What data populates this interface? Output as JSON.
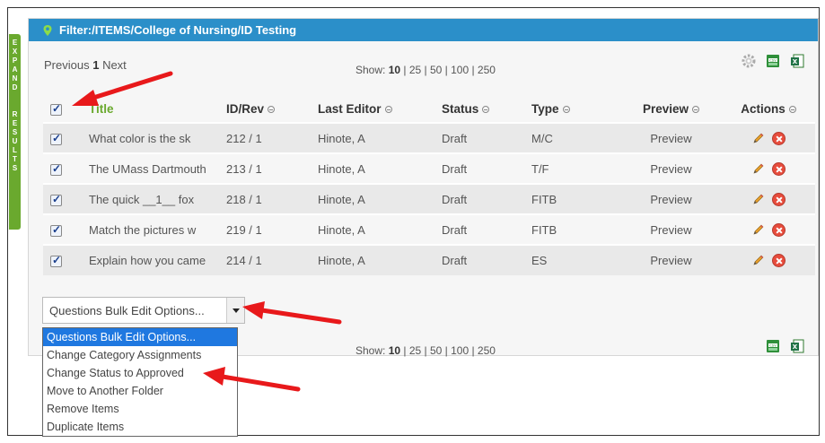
{
  "sidebar": {
    "expand_label": "EXPAND RESULTS"
  },
  "filter": {
    "label": "Filter:",
    "path": " /ITEMS/College of Nursing/ID Testing"
  },
  "pager": {
    "previous": "Previous",
    "current": "1",
    "next": "Next"
  },
  "show": {
    "label": "Show:",
    "current": "10",
    "others": "| 25 | 50 | 100 | 250"
  },
  "toolbar": {
    "settings_icon": "gear-icon",
    "csv_icon": "csv-icon",
    "excel_icon": "excel-icon"
  },
  "table": {
    "headers": {
      "title": "Title",
      "id_rev": "ID/Rev",
      "last_editor": "Last Editor",
      "status": "Status",
      "type": "Type",
      "preview": "Preview",
      "actions": "Actions"
    },
    "rows": [
      {
        "title": "What color is the sk",
        "id_rev": "212 / 1",
        "editor": "Hinote, A",
        "status": "Draft",
        "type": "M/C",
        "preview": "Preview"
      },
      {
        "title": "The UMass Dartmouth",
        "id_rev": "213 / 1",
        "editor": "Hinote, A",
        "status": "Draft",
        "type": "T/F",
        "preview": "Preview"
      },
      {
        "title": "The quick __1__ fox",
        "id_rev": "218 / 1",
        "editor": "Hinote, A",
        "status": "Draft",
        "type": "FITB",
        "preview": "Preview"
      },
      {
        "title": "Match the pictures w",
        "id_rev": "219 / 1",
        "editor": "Hinote, A",
        "status": "Draft",
        "type": "FITB",
        "preview": "Preview"
      },
      {
        "title": "Explain how you came",
        "id_rev": "214 / 1",
        "editor": "Hinote, A",
        "status": "Draft",
        "type": "ES",
        "preview": "Preview"
      }
    ]
  },
  "bulk_edit": {
    "selected": "Questions Bulk Edit Options...",
    "options": [
      "Questions Bulk Edit Options...",
      "Change Category Assignments",
      "Change Status to Approved",
      "Move to Another Folder",
      "Remove Items",
      "Duplicate Items"
    ]
  },
  "colors": {
    "header_blue": "#2b8fc9",
    "accent_green": "#6aa92e",
    "link_blue": "#2a7fc1",
    "arrow_red": "#e8191b",
    "selected_blue": "#1f78e0"
  }
}
